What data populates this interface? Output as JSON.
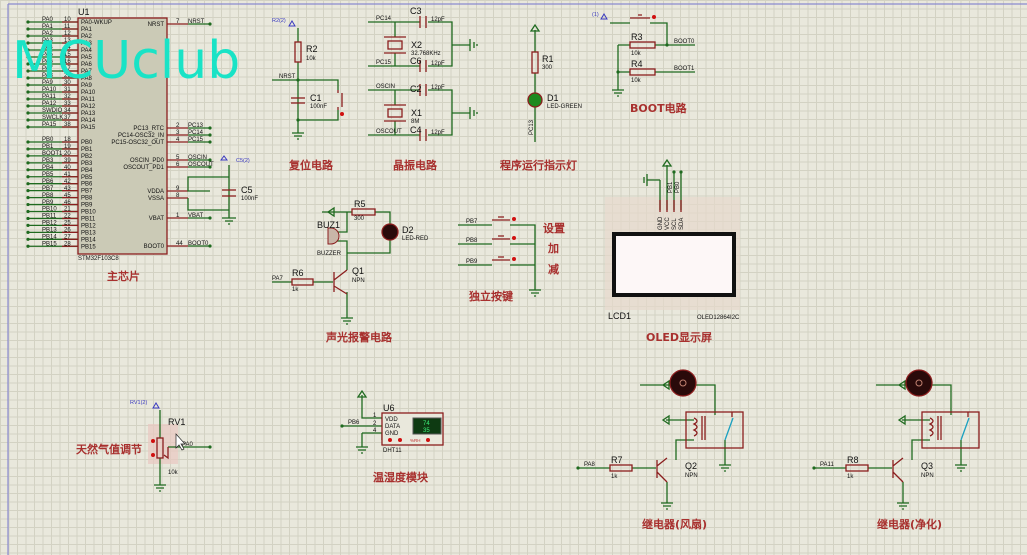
{
  "watermark": "MCUclub",
  "colors": {
    "wire": "#1f6a1f",
    "component": "#8b1e1e",
    "label": "#a8302e",
    "background": "#e9e8dc",
    "watermark": "#19e3c6",
    "led_green": "#1f8a1f",
    "terminal": "#3a3ac0"
  },
  "sections": {
    "main_chip": "主芯片",
    "reset": "复位电路",
    "crystal": "晶振电路",
    "led_indicator": "程序运行指示灯",
    "boot": "BOOT电路",
    "alarm": "声光报警电路",
    "keys": "独立按键",
    "oled": "OLED显示屏",
    "gas": "天然气值调节",
    "dht": "温湿度模块",
    "relay_fan": "继电器(风扇)",
    "relay_purify": "继电器(净化)"
  },
  "mcu": {
    "ref": "U1",
    "part": "STM32F103C8",
    "left_pins": [
      {
        "net": "PA0",
        "num": "10",
        "name": "PA0-WKUP"
      },
      {
        "net": "PA1",
        "num": "11",
        "name": "PA1"
      },
      {
        "net": "PA2",
        "num": "12",
        "name": "PA2"
      },
      {
        "net": "PA3",
        "num": "13",
        "name": "PA3"
      },
      {
        "net": "PA4",
        "num": "14",
        "name": "PA4"
      },
      {
        "net": "PA5",
        "num": "15",
        "name": "PA5"
      },
      {
        "net": "PA6",
        "num": "16",
        "name": "PA6"
      },
      {
        "net": "PA7",
        "num": "17",
        "name": "PA7"
      },
      {
        "net": "PA8",
        "num": "29",
        "name": "PA8"
      },
      {
        "net": "PA9",
        "num": "30",
        "name": "PA9"
      },
      {
        "net": "PA10",
        "num": "31",
        "name": "PA10"
      },
      {
        "net": "PA11",
        "num": "32",
        "name": "PA11"
      },
      {
        "net": "PA12",
        "num": "33",
        "name": "PA12"
      },
      {
        "net": "SWDIO",
        "num": "34",
        "name": "PA13"
      },
      {
        "net": "SWCLK",
        "num": "37",
        "name": "PA14"
      },
      {
        "net": "PA15",
        "num": "38",
        "name": "PA15"
      },
      {
        "net": "PB0",
        "num": "18",
        "name": "PB0"
      },
      {
        "net": "PB1",
        "num": "19",
        "name": "PB1"
      },
      {
        "net": "BOOT1",
        "num": "20",
        "name": "PB2"
      },
      {
        "net": "PB3",
        "num": "39",
        "name": "PB3"
      },
      {
        "net": "PB4",
        "num": "40",
        "name": "PB4"
      },
      {
        "net": "PB5",
        "num": "41",
        "name": "PB5"
      },
      {
        "net": "PB6",
        "num": "42",
        "name": "PB6"
      },
      {
        "net": "PB7",
        "num": "43",
        "name": "PB7"
      },
      {
        "net": "PB8",
        "num": "45",
        "name": "PB8"
      },
      {
        "net": "PB9",
        "num": "46",
        "name": "PB9"
      },
      {
        "net": "PB10",
        "num": "21",
        "name": "PB10"
      },
      {
        "net": "PB11",
        "num": "22",
        "name": "PB11"
      },
      {
        "net": "PB12",
        "num": "25",
        "name": "PB12"
      },
      {
        "net": "PB13",
        "num": "26",
        "name": "PB13"
      },
      {
        "net": "PB14",
        "num": "27",
        "name": "PB14"
      },
      {
        "net": "PB15",
        "num": "28",
        "name": "PB15"
      }
    ],
    "right_pins": [
      {
        "net": "NRST",
        "num": "7",
        "name": "NRST"
      },
      {
        "net": "PC13",
        "num": "2",
        "name": "PC13_RTC"
      },
      {
        "net": "PC14",
        "num": "3",
        "name": "PC14-OSC32_IN"
      },
      {
        "net": "PC15",
        "num": "4",
        "name": "PC15-OSC32_OUT"
      },
      {
        "net": "OSCIN",
        "num": "5",
        "name": "OSCIN_PD0"
      },
      {
        "net": "OSCOUT",
        "num": "6",
        "name": "OSCOUT_PD1"
      },
      {
        "net": "",
        "num": "9",
        "name": "VDDA"
      },
      {
        "net": "",
        "num": "8",
        "name": "VSSA"
      },
      {
        "net": "VBAT",
        "num": "1",
        "name": "VBAT"
      },
      {
        "net": "BOOT0",
        "num": "44",
        "name": "BOOT0"
      }
    ],
    "c5": {
      "ref": "C5",
      "value": "100nF",
      "terminal": "C5(2)"
    }
  },
  "reset": {
    "terminal": "R2(2)",
    "r_ref": "R2",
    "r_val": "10k",
    "net": "NRST",
    "c_ref": "C1",
    "c_val": "100nF"
  },
  "crystal": {
    "n1": "PC14",
    "n2": "PC15",
    "n3": "OSCIN",
    "n4": "OSCOUT",
    "x2": "X2",
    "x2_val": "32.768KHz",
    "x1": "X1",
    "x1_val": "8M",
    "c3": "C3",
    "c6": "C6",
    "c2": "C2",
    "c4": "C4",
    "cval": "12pF"
  },
  "led": {
    "r_ref": "R1",
    "r_val": "300",
    "d_ref": "D1",
    "d_val": "LED-GREEN",
    "net": "PC13"
  },
  "boot": {
    "terminal": "(1)",
    "r3": "R3",
    "r4": "R4",
    "rval": "10k",
    "n0": "BOOT0",
    "n1": "BOOT1"
  },
  "alarm": {
    "r5": "R5",
    "r5_val": "300",
    "d2": "D2",
    "d2_val": "LED-RED",
    "buz": "BUZ1",
    "buz_val": "BUZZER",
    "q1": "Q1",
    "q1_val": "NPN",
    "net": "PA7",
    "r6": "R6",
    "r6_val": "1k"
  },
  "keys": {
    "nets": [
      "PB7",
      "PB8",
      "PB9"
    ],
    "labels": [
      "设置",
      "加",
      "减"
    ]
  },
  "oled": {
    "pins": [
      "GND",
      "VCC",
      "SCL",
      "SDA"
    ],
    "nets": [
      "PB1",
      "PB0"
    ],
    "ref": "LCD1",
    "part": "OLED12864I2C"
  },
  "gas": {
    "terminal": "RV1(2)",
    "ref": "RV1",
    "net": "PA0",
    "value": "10k"
  },
  "dht": {
    "ref": "U6",
    "part": "DHT11",
    "net": "PB6",
    "pins": [
      {
        "num": "1",
        "name": "VDD"
      },
      {
        "num": "2",
        "name": "DATA"
      },
      {
        "num": "4",
        "name": "GND"
      }
    ],
    "display": [
      "74",
      "35"
    ],
    "unit": "%RH"
  },
  "relays": [
    {
      "net": "PA8",
      "r": "R7",
      "rval": "1k",
      "q": "Q2",
      "qval": "NPN"
    },
    {
      "net": "PA11",
      "r": "R8",
      "rval": "1k",
      "q": "Q3",
      "qval": "NPN"
    }
  ]
}
